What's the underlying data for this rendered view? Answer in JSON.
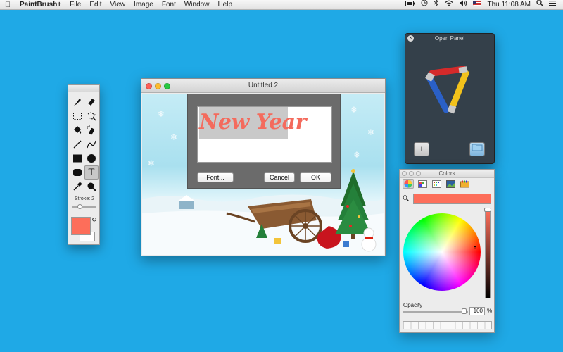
{
  "menubar": {
    "app_name": "PaintBrush+",
    "menus": [
      "File",
      "Edit",
      "View",
      "Image",
      "Font",
      "Window",
      "Help"
    ],
    "clock": "Thu 11:08 AM"
  },
  "tool_palette": {
    "stroke_label": "Stroke: 2",
    "stroke_value": 2,
    "foreground_color": "#fd6e5a",
    "background_color": "#ffffff"
  },
  "document": {
    "title": "Untitled 2",
    "sample_text": "New Year",
    "buttons": {
      "font": "Font...",
      "cancel": "Cancel",
      "ok": "OK"
    }
  },
  "open_panel": {
    "title": "Open Panel",
    "add_label": "+"
  },
  "colors_panel": {
    "title": "Colors",
    "selected_color": "#fd6e5a",
    "opacity_label": "Opacity",
    "opacity_value": "100",
    "opacity_unit": "%"
  }
}
